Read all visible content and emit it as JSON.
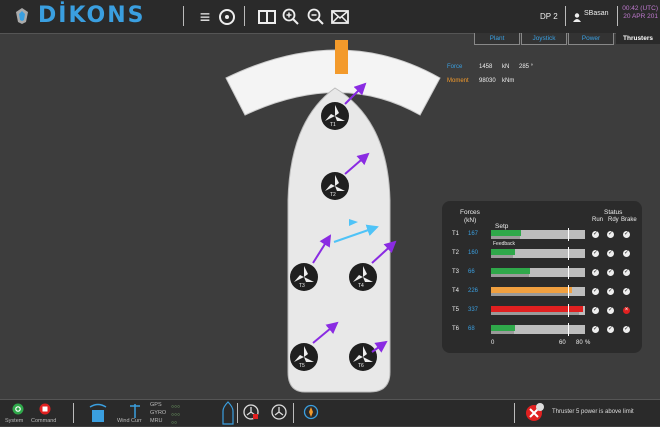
{
  "header": {
    "logo_text": "DİKONS",
    "dp_label": "DP 2",
    "user": "SBasan",
    "clock_time": "00:42 (UTC)",
    "clock_date": "20 APR 201"
  },
  "tabs": [
    {
      "label": "Plant"
    },
    {
      "label": "Joystick"
    },
    {
      "label": "Power"
    },
    {
      "label": "Thrusters"
    }
  ],
  "force_info": {
    "force_label": "Force",
    "force_value": "1458",
    "force_unit": "kN",
    "force_angle": "285 °",
    "moment_label": "Moment",
    "moment_value": "98030",
    "moment_unit": "kNm"
  },
  "thruster_labels": [
    "T1",
    "T2",
    "T3",
    "T4",
    "T5",
    "T6"
  ],
  "panel": {
    "forces_label": "Forces",
    "unit_label": "(kN)",
    "status_label": "Status",
    "setp_label": "Setp",
    "feedback_label": "Feedback",
    "status_cols": [
      "Run",
      "Rdy",
      "Brake"
    ],
    "axis_ticks": [
      "0",
      "60",
      "80",
      "%"
    ],
    "rows": [
      {
        "name": "T1",
        "value": "167",
        "percent": 32,
        "color": "#2fa84a"
      },
      {
        "name": "T2",
        "value": "160",
        "percent": 25,
        "color": "#2fa84a"
      },
      {
        "name": "T3",
        "value": "66",
        "percent": 42,
        "color": "#2fa84a"
      },
      {
        "name": "T4",
        "value": "226",
        "percent": 86,
        "color": "#f0a040"
      },
      {
        "name": "T5",
        "value": "337",
        "percent": 98,
        "color": "#e02020"
      },
      {
        "name": "T6",
        "value": "68",
        "percent": 26,
        "color": "#2fa84a"
      }
    ]
  },
  "bottom": {
    "system_label": "System",
    "command_label": "Command",
    "wind_label": "Wind Curr",
    "gps_label": "GPS",
    "gyro_label": "GYRO",
    "mru_label": "MRU",
    "alarm_text": "Thruster 5 power is above limit"
  },
  "colors": {
    "accent": "#3a9fe0",
    "purple_arrow": "#8a2be2",
    "warning": "#e02020",
    "compass_marker": "#f39a2b"
  }
}
